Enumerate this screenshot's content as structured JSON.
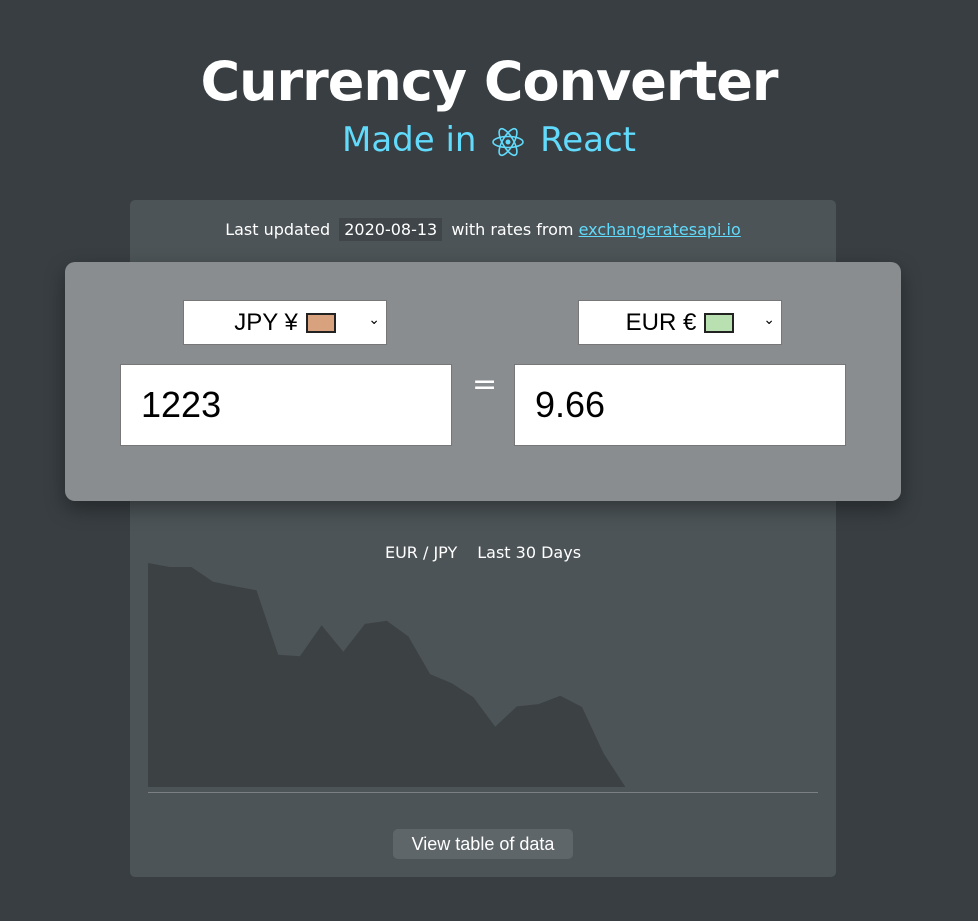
{
  "header": {
    "title": "Currency Converter",
    "subtitle_prefix": "Made in",
    "subtitle_suffix": "React"
  },
  "info": {
    "prefix": "Last updated",
    "date": "2020-08-13",
    "middle": "with rates from",
    "link": "exchangeratesapi.io"
  },
  "converter": {
    "from": {
      "currency": "JPY ¥",
      "amount": "1223",
      "flag_color": "#d9a27f"
    },
    "equals": "=",
    "to": {
      "currency": "EUR €",
      "amount": "9.66",
      "flag_color": "#b8e0b0"
    }
  },
  "chart_data": {
    "type": "area",
    "title_pair": "EUR / JPY",
    "title_range": "Last 30 Days",
    "values": [
      100,
      98.2,
      98.2,
      91.6,
      89.6,
      87.8,
      59,
      58.4,
      72.2,
      60.4,
      72.8,
      74.2,
      67.2,
      50.4,
      46.3,
      40,
      26.9,
      36,
      37,
      40.7,
      35.7,
      14.9,
      0
    ],
    "fill": "#3c4144"
  },
  "actions": {
    "view_table": "View table of data"
  }
}
